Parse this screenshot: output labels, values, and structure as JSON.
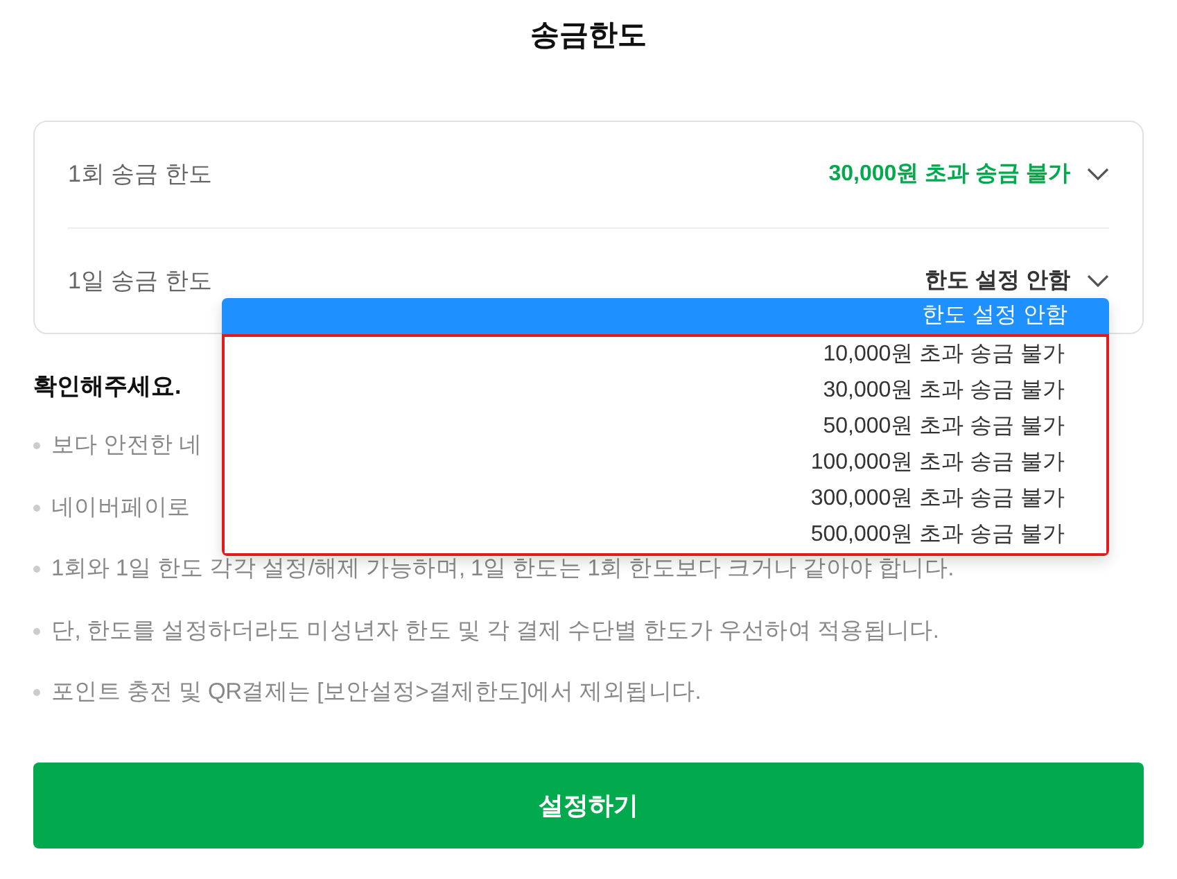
{
  "title": "송금한도",
  "limits": [
    {
      "label": "1회 송금 한도",
      "value": "30,000원 초과 송금 불가",
      "active": true
    },
    {
      "label": "1일 송금 한도",
      "value": "한도 설정 안함",
      "active": false
    }
  ],
  "dropdown": {
    "options": [
      {
        "label": "한도 설정 안함",
        "selected": true
      },
      {
        "label": "10,000원 초과 송금 불가",
        "selected": false
      },
      {
        "label": "30,000원 초과 송금 불가",
        "selected": false
      },
      {
        "label": "50,000원 초과 송금 불가",
        "selected": false
      },
      {
        "label": "100,000원 초과 송금 불가",
        "selected": false
      },
      {
        "label": "300,000원 초과 송금 불가",
        "selected": false
      },
      {
        "label": "500,000원 초과 송금 불가",
        "selected": false
      }
    ]
  },
  "notice": {
    "heading": "확인해주세요.",
    "items": [
      "보다 안전한 네",
      "네이버페이로",
      "1회와 1일 한도 각각 설정/해제 가능하며, 1일 한도는 1회 한도보다 크거나 같아야 합니다.",
      "단, 한도를 설정하더라도 미성년자 한도 및 각 결제 수단별 한도가 우선하여 적용됩니다.",
      "포인트 충전 및 QR결제는 [보안설정>결제한도]에서 제외됩니다."
    ]
  },
  "button": "설정하기"
}
